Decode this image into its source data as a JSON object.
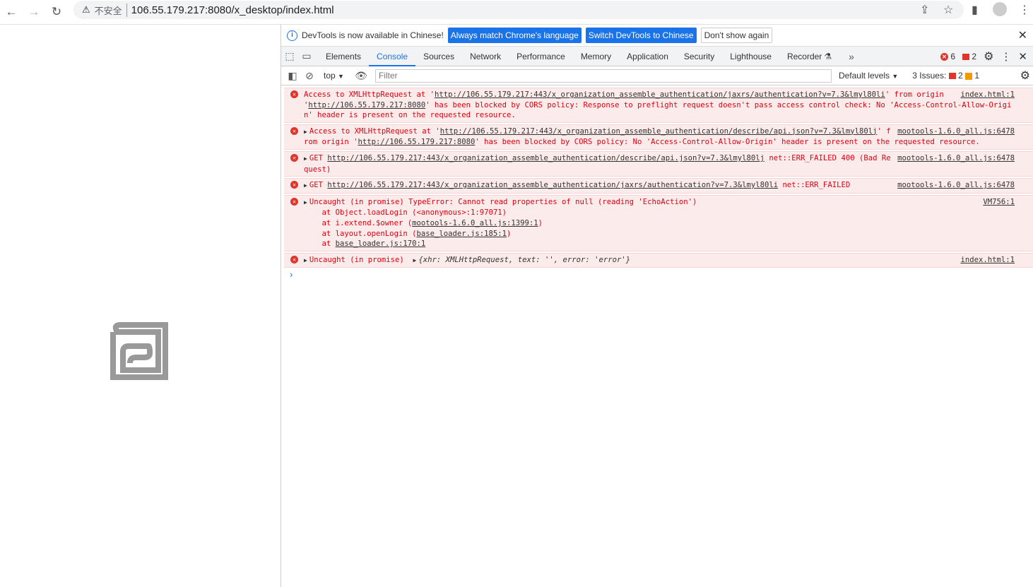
{
  "browser": {
    "url": "106.55.179.217:8080/x_desktop/index.html",
    "security": "不安全"
  },
  "infobar": {
    "text": "DevTools is now available in Chinese!",
    "btn1": "Always match Chrome's language",
    "btn2": "Switch DevTools to Chinese",
    "btn3": "Don't show again"
  },
  "tabs": [
    "Elements",
    "Console",
    "Sources",
    "Network",
    "Performance",
    "Memory",
    "Application",
    "Security",
    "Lighthouse",
    "Recorder"
  ],
  "counts": {
    "errors": "6",
    "warnings": "2"
  },
  "toolbar": {
    "context": "top",
    "filter_placeholder": "Filter",
    "levels": "Default levels",
    "issues_label": "3 Issues:",
    "issues_err": "2",
    "issues_warn": "1"
  },
  "messages": [
    {
      "pre": "Access to XMLHttpRequest at '",
      "url": "http://106.55.179.217:443/x_organization_assemble_authentication/jaxrs/authentication?v=7.3&lmyl80li",
      "mid": "' from origin '",
      "url2": "http://106.55.179.217:8080",
      "post": "' has been blocked by CORS policy: Response to preflight request doesn't pass access control check: No 'Access-Control-Allow-Origin' header is present on the requested resource.",
      "src": "index.html:1"
    },
    {
      "pre": "Access to XMLHttpRequest at '",
      "url": "http://106.55.179.217:443/x_organization_assemble_authentication/describe/api.json?v=7.3&lmyl80lj",
      "mid": "' from origin '",
      "url2": "http://106.55.179.217:8080",
      "post": "' has been blocked by CORS policy: No 'Access-Control-Allow-Origin' header is present on the requested resource.",
      "src": "mootools-1.6.0_all.js:6478"
    },
    {
      "pre": "GET ",
      "url": "http://106.55.179.217:443/x_organization_assemble_authentication/describe/api.json?v=7.3&lmyl80lj",
      "post": " net::ERR_FAILED 400 (Bad Request)",
      "src": "mootools-1.6.0_all.js:6478"
    },
    {
      "pre": "GET ",
      "url": "http://106.55.179.217:443/x_organization_assemble_authentication/jaxrs/authentication?v=7.3&lmyl80li",
      "post": " net::ERR_FAILED",
      "src": "mootools-1.6.0_all.js:6478"
    },
    {
      "line1": "Uncaught (in promise) TypeError: Cannot read properties of null (reading 'EchoAction')",
      "st1": "    at Object.loadLogin (<anonymous>:1:97071)",
      "st2a": "    at i.extend.$owner (",
      "st2l": "mootools-1.6.0_all.js:1399:1",
      "st3a": "    at layout.openLogin (",
      "st3l": "base_loader.js:185:1",
      "st4a": "    at ",
      "st4l": "base_loader.js:170:1",
      "close": ")",
      "src": "VM756:1"
    },
    {
      "pre": "Uncaught (in promise) ",
      "obj": "{xhr: XMLHttpRequest, text: '', error: 'error'}",
      "src": "index.html:1"
    }
  ]
}
